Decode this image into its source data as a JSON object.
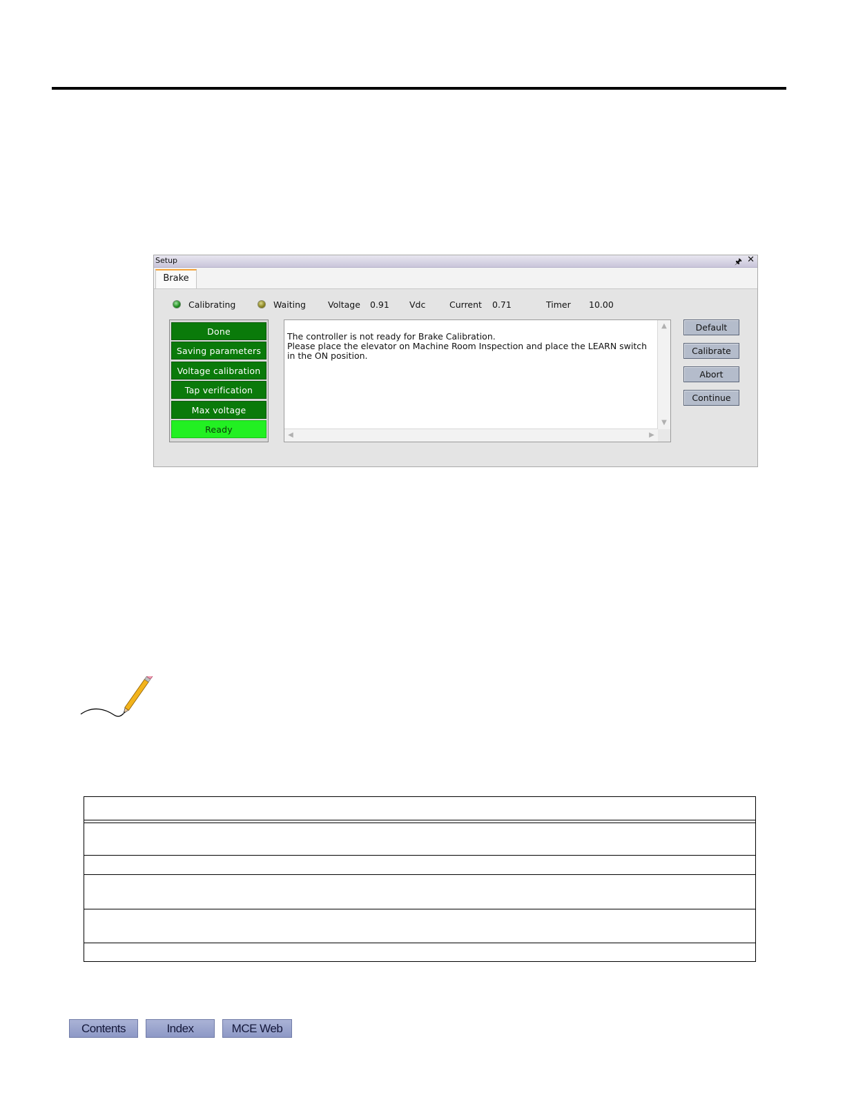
{
  "window": {
    "title": "Setup",
    "tab": "Brake"
  },
  "status": {
    "calibrating_label": "Calibrating",
    "waiting_label": "Waiting",
    "voltage_label": "Voltage",
    "voltage_value": "0.91",
    "voltage_unit": "Vdc",
    "current_label": "Current",
    "current_value": "0.71",
    "timer_label": "Timer",
    "timer_value": "10.00"
  },
  "steps": {
    "items": [
      "Done",
      "Saving parameters",
      "Voltage calibration",
      "Tap verification",
      "Max voltage",
      "Ready"
    ],
    "active": "Ready"
  },
  "message": {
    "line1": "The controller is not ready for Brake Calibration.",
    "line2": "Please place the elevator on Machine Room Inspection and place the LEARN switch",
    "line3": "in the ON position."
  },
  "buttons": {
    "default": "Default",
    "calibrate": "Calibrate",
    "abort": "Abort",
    "continue": "Continue"
  },
  "footer": {
    "contents": "Contents",
    "index": "Index",
    "mce_web": "MCE Web"
  },
  "icons": {
    "pin": "pin-icon",
    "close": "close-icon",
    "note": "pencil-note-icon"
  },
  "colors": {
    "step_done": "#0a7a0a",
    "step_active": "#22f022",
    "button": "#b4bccb",
    "nav_button": "#9aa4cf"
  }
}
